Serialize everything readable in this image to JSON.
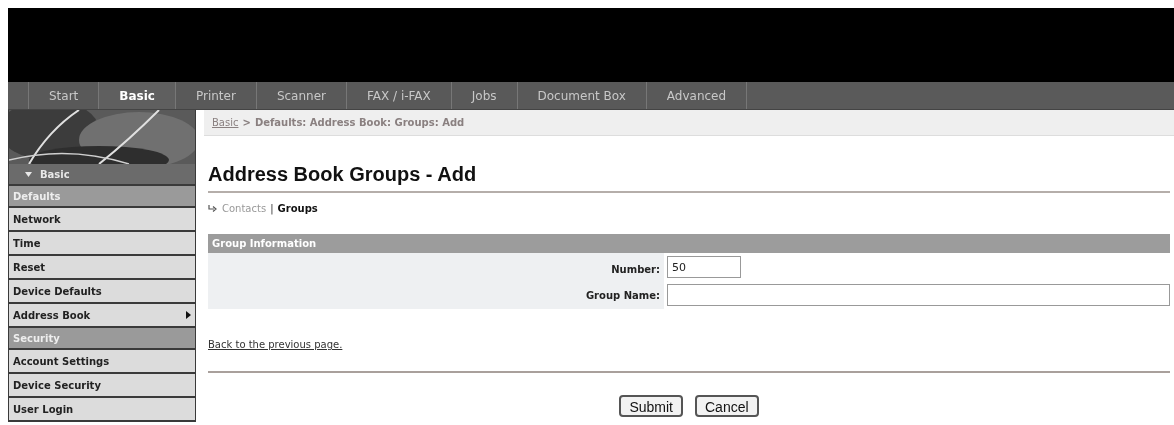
{
  "tabs": [
    {
      "label": "Start",
      "selected": false
    },
    {
      "label": "Basic",
      "selected": true
    },
    {
      "label": "Printer",
      "selected": false
    },
    {
      "label": "Scanner",
      "selected": false
    },
    {
      "label": "FAX / i-FAX",
      "selected": false
    },
    {
      "label": "Jobs",
      "selected": false
    },
    {
      "label": "Document Box",
      "selected": false
    },
    {
      "label": "Advanced",
      "selected": false
    }
  ],
  "sidebar": {
    "items": [
      {
        "kind": "header",
        "label": "Basic"
      },
      {
        "kind": "section",
        "label": "Defaults"
      },
      {
        "kind": "link",
        "label": "Network",
        "submenu": false
      },
      {
        "kind": "link",
        "label": "Time",
        "submenu": false
      },
      {
        "kind": "link",
        "label": "Reset",
        "submenu": false
      },
      {
        "kind": "link",
        "label": "Device Defaults",
        "submenu": false
      },
      {
        "kind": "link",
        "label": "Address Book",
        "submenu": true
      },
      {
        "kind": "section",
        "label": "Security"
      },
      {
        "kind": "link",
        "label": "Account Settings",
        "submenu": false
      },
      {
        "kind": "link",
        "label": "Device Security",
        "submenu": false
      },
      {
        "kind": "link",
        "label": "User Login",
        "submenu": false
      }
    ]
  },
  "breadcrumb": {
    "link": "Basic",
    "separator": ">",
    "path": "Defaults: Address Book: Groups: Add"
  },
  "title": "Address Book Groups - Add",
  "subnav": [
    {
      "label": "Contacts",
      "selected": false
    },
    {
      "label": "Groups",
      "selected": true
    }
  ],
  "subnav_separator": "|",
  "section": {
    "title": "Group Information",
    "fields": [
      {
        "label": "Number:",
        "value": "50"
      },
      {
        "label": "Group Name:"
      }
    ]
  },
  "back_link": "Back to the previous page.",
  "buttons": [
    "Submit",
    "Cancel"
  ]
}
